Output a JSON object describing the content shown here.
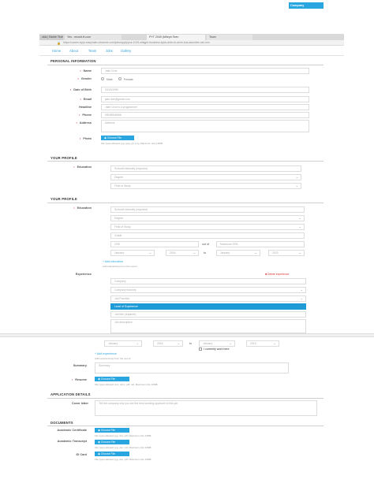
{
  "browser": {
    "tabs": [
      "ckla | Barrie Tech",
      "Yes - recruit.tf.com",
      "PYT 2049 (Mileph Teen",
      "Team"
    ],
    "url": "https://career-byys.easyhalm.urbanine.com/jobs/apply/pos-1015-wbtgph-business-kylar-anim-in-anim-bus-aaumber-xal.com"
  },
  "nav": {
    "links": [
      "Home",
      "About",
      "Team",
      "Jobs",
      "Gallery"
    ],
    "cta": "Company"
  },
  "personal": {
    "title": "PERSONAL INFORMATION",
    "name_label": "Name",
    "name_value": "Jake Croe",
    "gender_label": "Gender",
    "gender_options": [
      "Male",
      "Female"
    ],
    "dob_label": "Date of Birth",
    "dob_value": "03/20/1990",
    "email_label": "Email",
    "email_value": "jake.doe@gmail.com",
    "headline_label": "Headline",
    "headline_value": "Jake Croe is a programmer",
    "phone_label": "Phone",
    "phone_value": "08155548686",
    "address_label": "Address",
    "address_value": "Address",
    "photo_label": "Photo",
    "photo_button": "Choose File",
    "photo_hint": "File types allowed: jpg, jpeg, gif, png. Maximum size 10MB."
  },
  "profile1": {
    "title": "YOUR PROFILE",
    "education_label": "Education",
    "school": "School/University (required)",
    "degree": "Degree",
    "field": "Field of Study"
  },
  "profile2": {
    "title": "YOUR PROFILE",
    "education_label": "Education",
    "school": "School/University (required)",
    "degree": "Degree",
    "field": "Field of Study",
    "grade": "Grade",
    "gpa": "GPA",
    "out_of": "out of",
    "max_gpa": "Maximum GPA",
    "from_month": "January",
    "from_year": "2016",
    "to": "to",
    "to_month": "January",
    "to_year": "2023",
    "add_education": "+ Add education",
    "add_education_hint": "Add education(s) from the recent",
    "experience_label": "Experience",
    "delete_experience": "Delete experience",
    "company": "Company",
    "industry": "Company Industry",
    "job_function": "Job Function",
    "level": "Level of Experience",
    "job_title": "Job title (required)",
    "job_description": "Job description",
    "exp_from_month": "January",
    "exp_from_year": "2016",
    "exp_to": "to",
    "exp_to_month": "January",
    "exp_to_year": "2019",
    "currently_work": "I currently work here",
    "add_experience": "+ Add experience",
    "add_experience_hint": "Add experience(s) from the recent",
    "summary_label": "Summary",
    "summary_placeholder": "Summary",
    "resume_label": "Resume",
    "resume_button": "Choose File",
    "resume_hint": "File types allowed: doc, docx, pdf, odt. Maximum size 10MB."
  },
  "application": {
    "title": "APPLICATION DETAILS",
    "cover_label": "Cover letter",
    "cover_placeholder": "Tell the company why you are the best working applicant to this job"
  },
  "documents": {
    "title": "DOCUMENTS",
    "items": [
      {
        "label": "Academic Certificate",
        "button": "Choose File",
        "hint": "File types allowed: jpg, doc, pdf. Maximum size 10MB."
      },
      {
        "label": "Academic Transcript",
        "button": "Choose File",
        "hint": "File types allowed: jpg, doc, pdf. Maximum size 10MB."
      },
      {
        "label": "ID Card",
        "button": "Choose File",
        "hint": "File types allowed: jpg, doc, pdf. Maximum size 10MB."
      }
    ]
  }
}
